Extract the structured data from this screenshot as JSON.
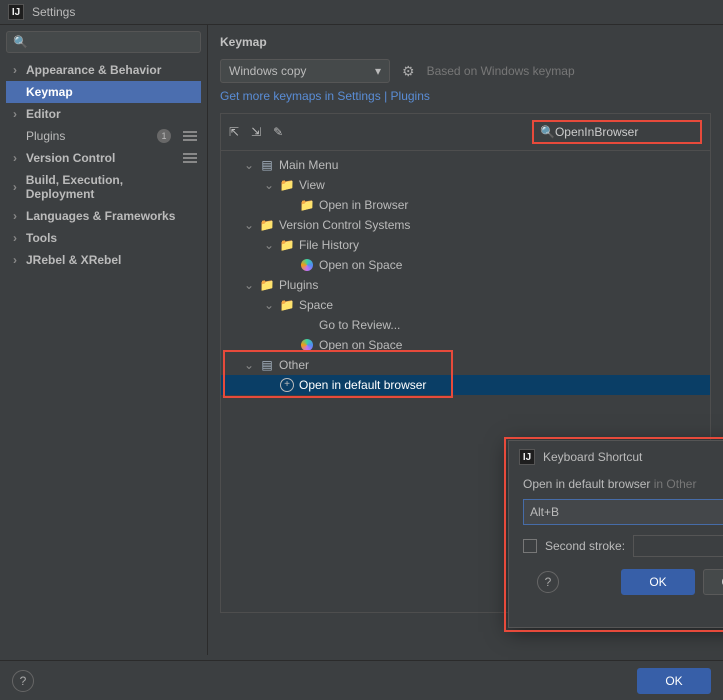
{
  "window": {
    "title": "Settings"
  },
  "sidebar": {
    "search_placeholder": "",
    "items": [
      {
        "label": "Appearance & Behavior",
        "chev": "›",
        "bold": true
      },
      {
        "label": "Keymap",
        "bold": true,
        "selected": true
      },
      {
        "label": "Editor",
        "chev": "›",
        "bold": true
      },
      {
        "label": "Plugins",
        "badge": "1",
        "dots": true
      },
      {
        "label": "Version Control",
        "chev": "›",
        "bold": true,
        "dots": true
      },
      {
        "label": "Build, Execution, Deployment",
        "chev": "›",
        "bold": true
      },
      {
        "label": "Languages & Frameworks",
        "chev": "›",
        "bold": true
      },
      {
        "label": "Tools",
        "chev": "›",
        "bold": true
      },
      {
        "label": "JRebel & XRebel",
        "chev": "›",
        "bold": true
      }
    ]
  },
  "page": {
    "title": "Keymap",
    "combo_value": "Windows copy",
    "based_on": "Based on Windows keymap",
    "link_text": "Get more keymaps in Settings | Plugins",
    "search_value": "OpenInBrowser"
  },
  "tree": [
    {
      "depth": 0,
      "chev": "⌄",
      "icon": "menu",
      "label": "Main Menu"
    },
    {
      "depth": 1,
      "chev": "⌄",
      "icon": "folder",
      "label": "View"
    },
    {
      "depth": 2,
      "icon": "folder",
      "label": "Open in Browser"
    },
    {
      "depth": 0,
      "chev": "⌄",
      "icon": "folder",
      "label": "Version Control Systems"
    },
    {
      "depth": 1,
      "chev": "⌄",
      "icon": "folder",
      "label": "File History"
    },
    {
      "depth": 2,
      "icon": "space",
      "label": "Open on Space"
    },
    {
      "depth": 0,
      "chev": "⌄",
      "icon": "folder",
      "label": "Plugins"
    },
    {
      "depth": 1,
      "chev": "⌄",
      "icon": "folder",
      "label": "Space"
    },
    {
      "depth": 2,
      "label": "Go to Review..."
    },
    {
      "depth": 2,
      "icon": "space",
      "label": "Open on Space"
    },
    {
      "depth": 0,
      "chev": "⌄",
      "icon": "menu",
      "label": "Other"
    },
    {
      "depth": 1,
      "icon": "globe",
      "label": "Open in default browser",
      "selected": true
    }
  ],
  "dialog": {
    "title": "Keyboard Shortcut",
    "subtitle_action": "Open in default browser",
    "subtitle_context": "in Other",
    "shortcut_value": "Alt+B",
    "second_stroke_label": "Second stroke:",
    "ok": "OK",
    "cancel": "Cancel"
  },
  "footer": {
    "ok": "OK"
  }
}
